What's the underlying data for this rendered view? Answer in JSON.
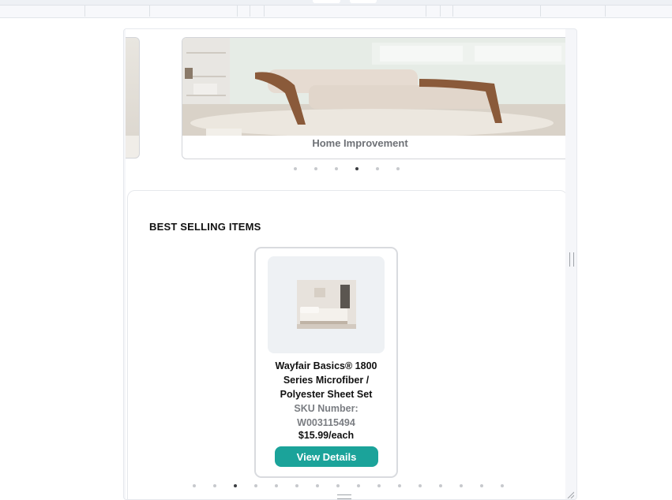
{
  "carousel": {
    "caption": "Home Improvement",
    "dot_count": 6,
    "active_index": 3
  },
  "best_selling": {
    "title": "BEST SELLING ITEMS",
    "product": {
      "name": "Wayfair Basics® 1800 Series Microfiber / Polyester Sheet Set",
      "sku": "SKU Number: W003115494",
      "price": "$15.99/each",
      "button": "View Details"
    },
    "dot_count": 16,
    "active_index": 2
  },
  "colors": {
    "accent": "#1ba39a",
    "text": "#111111",
    "muted": "#7a7d82"
  }
}
